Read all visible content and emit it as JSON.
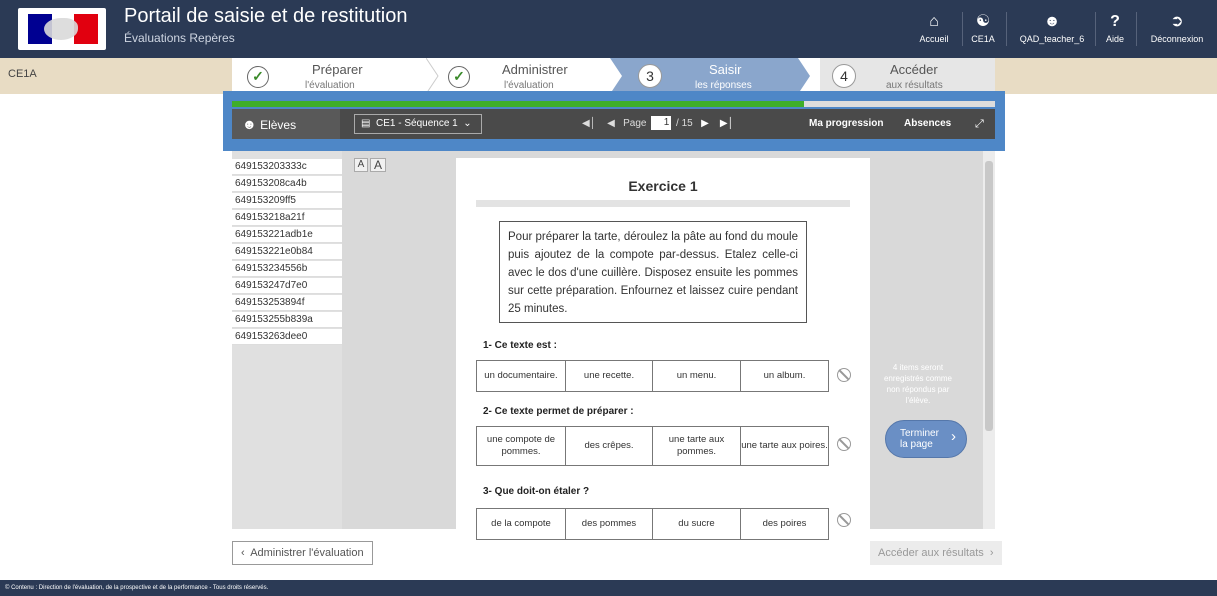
{
  "header": {
    "title": "Portail de saisie et de restitution",
    "subtitle": "Évaluations Repères",
    "nav": [
      {
        "icon": "home-icon",
        "label": "Accueil"
      },
      {
        "icon": "users-icon",
        "label": "CE1A"
      },
      {
        "icon": "user-icon",
        "label": "QAD_teacher_6"
      },
      {
        "icon": "help-icon",
        "label": "Aide"
      },
      {
        "icon": "logout-icon",
        "label": "Déconnexion"
      }
    ]
  },
  "class_label": "CE1A",
  "steps": [
    {
      "title": "Préparer",
      "sub": "l'évaluation",
      "state": "done"
    },
    {
      "title": "Administrer",
      "sub": "l'évaluation",
      "state": "done"
    },
    {
      "num": "3",
      "title": "Saisir",
      "sub": "les réponses",
      "state": "active"
    },
    {
      "num": "4",
      "title": "Accéder",
      "sub": "aux résultats",
      "state": "todo"
    }
  ],
  "progress": 0.75,
  "toolbar": {
    "eleves": "Elèves",
    "sequence": "CE1 - Séquence 1",
    "page_label": "Page",
    "page_current": "1",
    "page_total": "/ 15",
    "ma_progression": "Ma progression",
    "absences": "Absences"
  },
  "students": [
    "649153203333c",
    "649153208ca4b",
    "649153209ff5",
    "649153218a21f",
    "649153221adb1e",
    "649153221e0b84",
    "649153234556b",
    "649153247d7e0",
    "649153253894f",
    "649153255b839a",
    "649153263dee0"
  ],
  "font_buttons": [
    "A",
    "A"
  ],
  "exercise": {
    "title": "Exercice 1",
    "text": "Pour préparer la tarte, déroulez la pâte au fond du moule puis ajoutez de la compote par-dessus. Etalez celle-ci avec le dos d'une cuillère. Disposez ensuite les pommes sur cette préparation. Enfournez et laissez cuire pendant 25 minutes.",
    "questions": [
      {
        "q": "1- Ce texte est :",
        "options": [
          "un documentaire.",
          "une recette.",
          "un menu.",
          "un album."
        ]
      },
      {
        "q": "2- Ce texte permet de préparer :",
        "options": [
          "une compote de pommes.",
          "des crêpes.",
          "une tarte aux pommes.",
          "une tarte aux poires."
        ]
      },
      {
        "q": "3- Que doit-on étaler ?",
        "options": [
          "de la compote",
          "des pommes",
          "du sucre",
          "des poires"
        ]
      }
    ]
  },
  "info_text": "4 items seront enregistrés comme non répondus par l'élève.",
  "finish_button": "Terminer la page",
  "footer_buttons": {
    "prev": "Administrer l'évaluation",
    "next": "Accéder aux résultats"
  },
  "footer_text": "© Contenu : Direction de l'évaluation, de la prospective et de la performance - Tous droits réservés.",
  "colors": {
    "header": "#2b3a55",
    "accent": "#4e87c7",
    "progress": "#3fae2a",
    "active_step": "#8aa6cc"
  }
}
